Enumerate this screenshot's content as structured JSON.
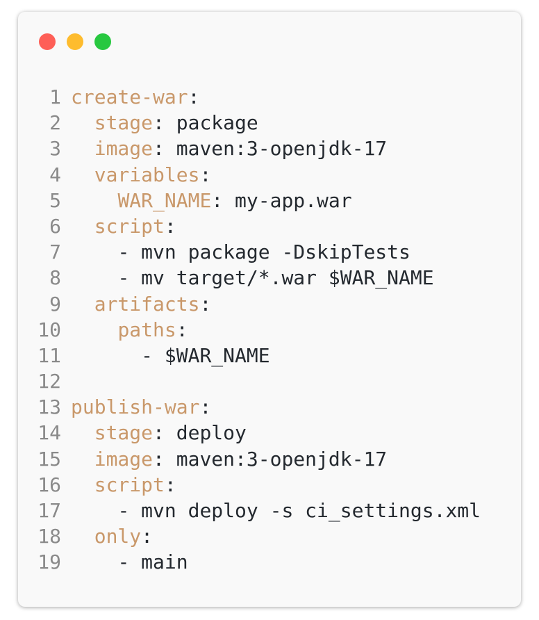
{
  "colors": {
    "window_bg": "#f9f9f9",
    "line_number": "#8a8a8a",
    "key": "#c9986a",
    "text": "#24292f",
    "dot_close": "#fe5f57",
    "dot_minimize": "#febc2e",
    "dot_maximize": "#28c840"
  },
  "code_lines": [
    {
      "num": "1",
      "indent": "",
      "key": "create-war",
      "sep": ":",
      "value": ""
    },
    {
      "num": "2",
      "indent": "  ",
      "key": "stage",
      "sep": ": ",
      "value": "package"
    },
    {
      "num": "3",
      "indent": "  ",
      "key": "image",
      "sep": ": ",
      "value": "maven:3-openjdk-17"
    },
    {
      "num": "4",
      "indent": "  ",
      "key": "variables",
      "sep": ":",
      "value": ""
    },
    {
      "num": "5",
      "indent": "    ",
      "key": "WAR_NAME",
      "sep": ": ",
      "value": "my-app.war"
    },
    {
      "num": "6",
      "indent": "  ",
      "key": "script",
      "sep": ":",
      "value": ""
    },
    {
      "num": "7",
      "indent": "    ",
      "key": "",
      "sep": "",
      "value": "- mvn package -DskipTests"
    },
    {
      "num": "8",
      "indent": "    ",
      "key": "",
      "sep": "",
      "value": "- mv target/*.war $WAR_NAME"
    },
    {
      "num": "9",
      "indent": "  ",
      "key": "artifacts",
      "sep": ":",
      "value": ""
    },
    {
      "num": "10",
      "indent": "    ",
      "key": "paths",
      "sep": ":",
      "value": ""
    },
    {
      "num": "11",
      "indent": "      ",
      "key": "",
      "sep": "",
      "value": "- $WAR_NAME"
    },
    {
      "num": "12",
      "indent": "",
      "key": "",
      "sep": "",
      "value": ""
    },
    {
      "num": "13",
      "indent": "",
      "key": "publish-war",
      "sep": ":",
      "value": ""
    },
    {
      "num": "14",
      "indent": "  ",
      "key": "stage",
      "sep": ": ",
      "value": "deploy"
    },
    {
      "num": "15",
      "indent": "  ",
      "key": "image",
      "sep": ": ",
      "value": "maven:3-openjdk-17"
    },
    {
      "num": "16",
      "indent": "  ",
      "key": "script",
      "sep": ":",
      "value": ""
    },
    {
      "num": "17",
      "indent": "    ",
      "key": "",
      "sep": "",
      "value": "- mvn deploy -s ci_settings.xml"
    },
    {
      "num": "18",
      "indent": "  ",
      "key": "only",
      "sep": ":",
      "value": ""
    },
    {
      "num": "19",
      "indent": "    ",
      "key": "",
      "sep": "",
      "value": "- main"
    }
  ]
}
